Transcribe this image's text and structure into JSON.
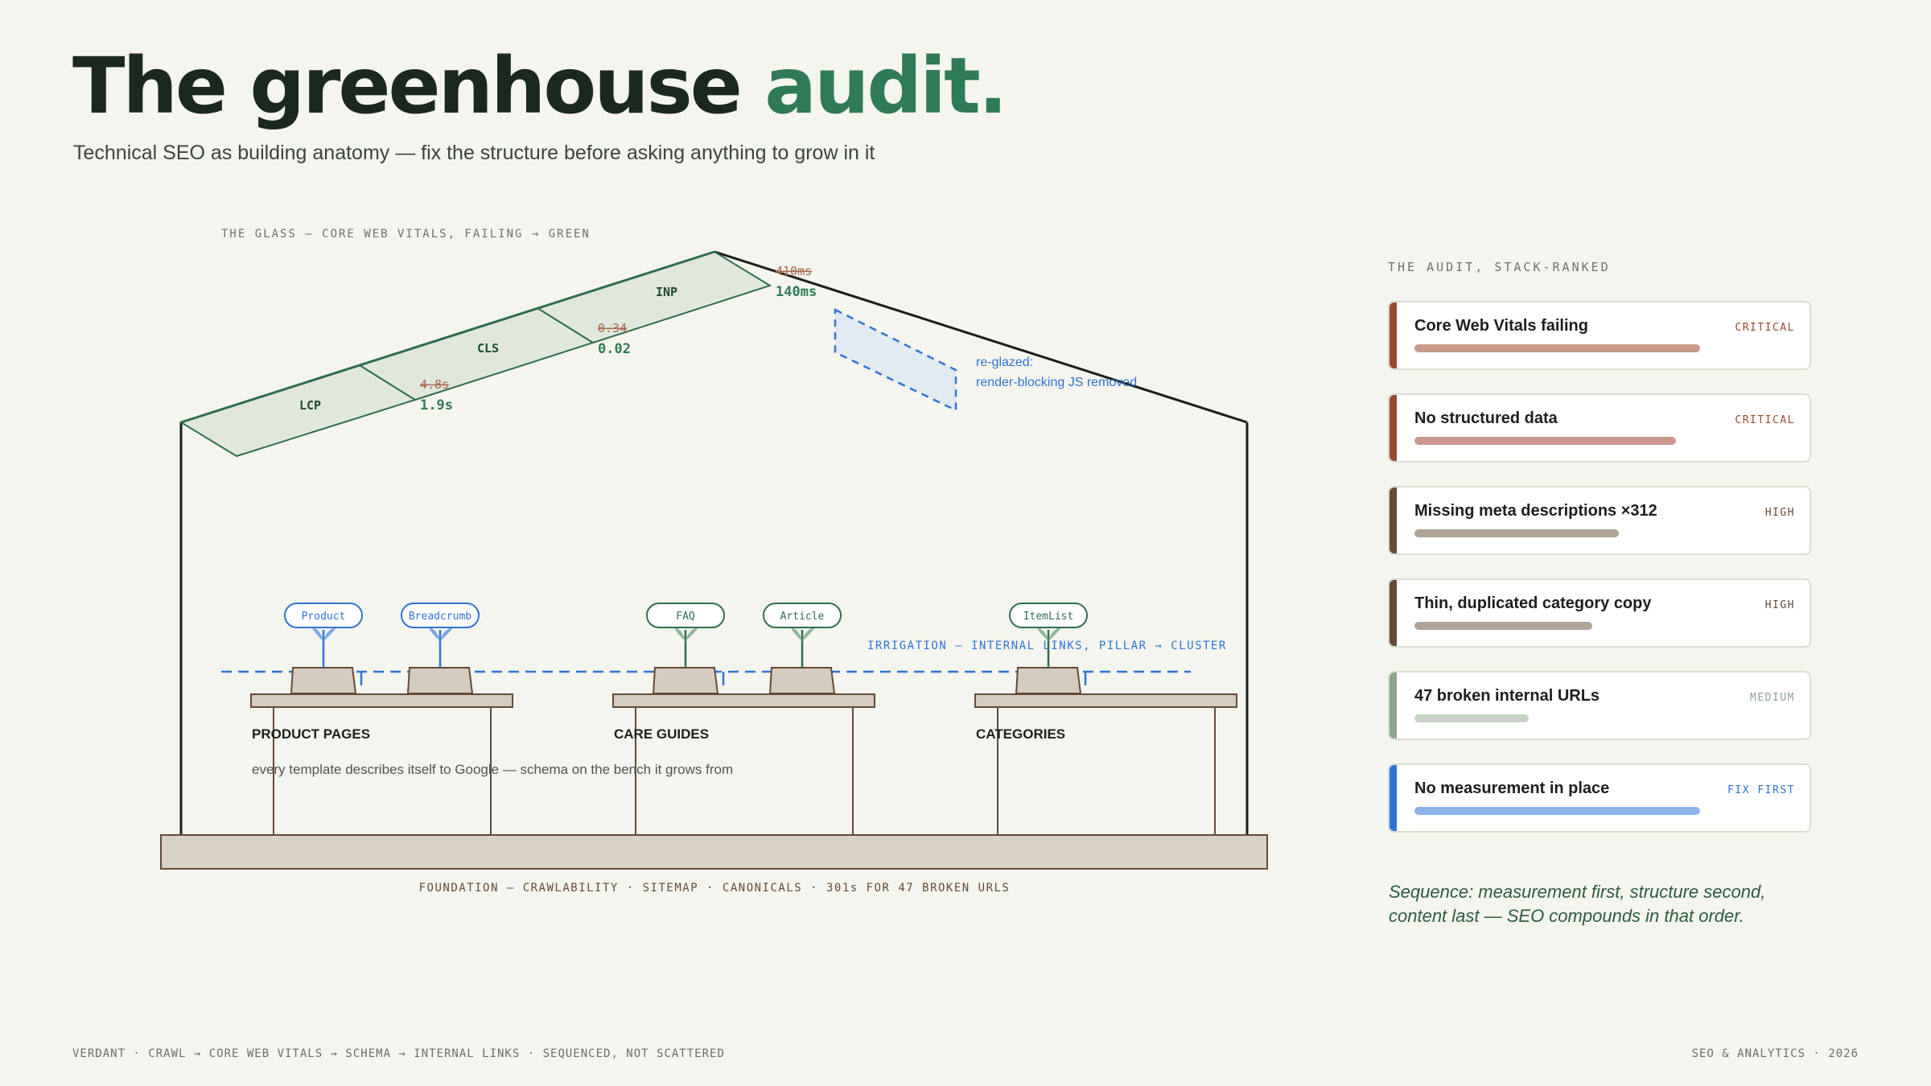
{
  "header": {
    "title_main": "The greenhouse",
    "title_accent": "audit.",
    "subtitle": "Technical SEO as building anatomy — fix the structure before asking anything to grow in it"
  },
  "diagram": {
    "glass_label": "THE GLASS — CORE WEB VITALS, FAILING → GREEN",
    "panes": [
      {
        "name": "LCP",
        "old": "4.8s",
        "new": "1.9s"
      },
      {
        "name": "CLS",
        "old": "0.34",
        "new": "0.02"
      },
      {
        "name": "INP",
        "old": "410ms",
        "new": "140ms"
      }
    ],
    "reglazed": {
      "line1": "re-glazed:",
      "line2": "render-blocking JS removed"
    },
    "irrigation_label": "IRRIGATION — INTERNAL LINKS, PILLAR → CLUSTER",
    "benches": [
      {
        "label": "PRODUCT PAGES",
        "tags": [
          "Product",
          "Breadcrumb"
        ]
      },
      {
        "label": "CARE GUIDES",
        "tags": [
          "FAQ",
          "Article"
        ]
      },
      {
        "label": "CATEGORIES",
        "tags": [
          "ItemList"
        ]
      }
    ],
    "schema_note": "every template describes itself to Google — schema on the bench it grows from",
    "foundation_label": "FOUNDATION — CRAWLABILITY · SITEMAP · CANONICALS · 301s FOR 47 BROKEN URLS"
  },
  "audit": {
    "heading": "THE AUDIT, STACK-RANKED",
    "items": [
      {
        "label": "Core Web Vitals failing",
        "severity": "CRITICAL",
        "level": 0.95,
        "color": "#9a4a32",
        "bar_color": "#c99a8b"
      },
      {
        "label": "No structured data",
        "severity": "CRITICAL",
        "level": 0.87,
        "color": "#9a4a32",
        "bar_color": "#c99a8b"
      },
      {
        "label": "Missing meta descriptions ×312",
        "severity": "HIGH",
        "level": 0.68,
        "color": "#654a36",
        "bar_color": "#b0a496"
      },
      {
        "label": "Thin, duplicated category copy",
        "severity": "HIGH",
        "level": 0.59,
        "color": "#654a36",
        "bar_color": "#b0a496"
      },
      {
        "label": "47 broken internal URLs",
        "severity": "MEDIUM",
        "level": 0.38,
        "color": "#8da58b",
        "bar_color": "#c7d3c4"
      },
      {
        "label": "No measurement in place",
        "severity": "FIX FIRST",
        "level": 0.95,
        "color": "#2f74d2",
        "bar_color": "#8eb3ea"
      }
    ],
    "note": "Sequence: measurement first, structure second, content last — SEO compounds in that order."
  },
  "footer": {
    "left": "VERDANT · CRAWL → CORE WEB VITALS → SCHEMA → INTERNAL LINKS · SEQUENCED, NOT SCATTERED",
    "right": "SEO & ANALYTICS · 2026"
  }
}
